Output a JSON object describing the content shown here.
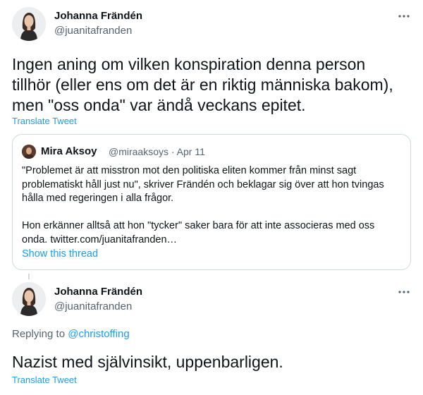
{
  "tweet1": {
    "author_name": "Johanna Frändén",
    "author_handle": "@juanitafranden",
    "text_lines": [
      "Ingen aning om vilken konspiration denna person",
      "tillhör (eller ens om det är en riktig människa bakom),",
      "men \"oss onda\" var ändå veckans epitet."
    ],
    "translate_label": "Translate Tweet"
  },
  "quote": {
    "author_name": "Mira Aksoy",
    "meta": "@miraaksoys · Apr 11",
    "paragraph1_lines": [
      "\"Problemet är att misstron mot den politiska eliten kommer från minst sagt",
      "problematiskt håll just nu\", skriver Frändén och beklagar sig över att hon tvingas",
      "hålla med regeringen i alla frågor."
    ],
    "paragraph2_lines": [
      "Hon erkänner alltså att hon \"tycker\" saker bara för att inte associeras med oss",
      "onda. twitter.com/juanitafranden…"
    ],
    "show_thread_label": "Show this thread"
  },
  "tweet2": {
    "author_name": "Johanna Frändén",
    "author_handle": "@juanitafranden",
    "replying_prefix": "Replying to ",
    "replying_mention": "@christoffing",
    "text": "Nazist med självinsikt, uppenbarligen.",
    "translate_label": "Translate Tweet"
  },
  "icons": {
    "more": "more-horizontal-icon",
    "avatar": "user-avatar"
  },
  "colors": {
    "accent": "#1d9bf0",
    "secondary_text": "#536471",
    "border": "#cfd9de"
  }
}
